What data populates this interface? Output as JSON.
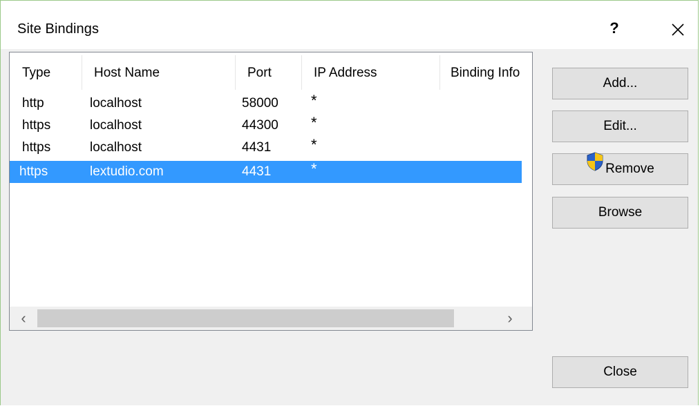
{
  "window": {
    "title": "Site Bindings",
    "help_label": "?"
  },
  "list": {
    "columns": [
      "Type",
      "Host Name",
      "Port",
      "IP Address",
      "Binding Info"
    ],
    "rows": [
      {
        "type": "http",
        "host": "localhost",
        "port": "58000",
        "ip": "*",
        "info": ""
      },
      {
        "type": "https",
        "host": "localhost",
        "port": "44300",
        "ip": "*",
        "info": ""
      },
      {
        "type": "https",
        "host": "localhost",
        "port": "4431",
        "ip": "*",
        "info": ""
      },
      {
        "type": "https",
        "host": "lextudio.com",
        "port": "4431",
        "ip": "*",
        "info": "",
        "selected": true
      }
    ]
  },
  "scrollbar": {
    "left_arrow": "‹",
    "right_arrow": "›"
  },
  "buttons": {
    "add": "Add...",
    "edit": "Edit...",
    "remove": "Remove",
    "browse": "Browse",
    "close": "Close"
  },
  "icons": {
    "close": "close-x-icon",
    "remove": "uac-shield-icon"
  },
  "colors": {
    "selection": "#3399ff",
    "window_border": "#9bc98a",
    "button_face": "#e1e1e1"
  }
}
